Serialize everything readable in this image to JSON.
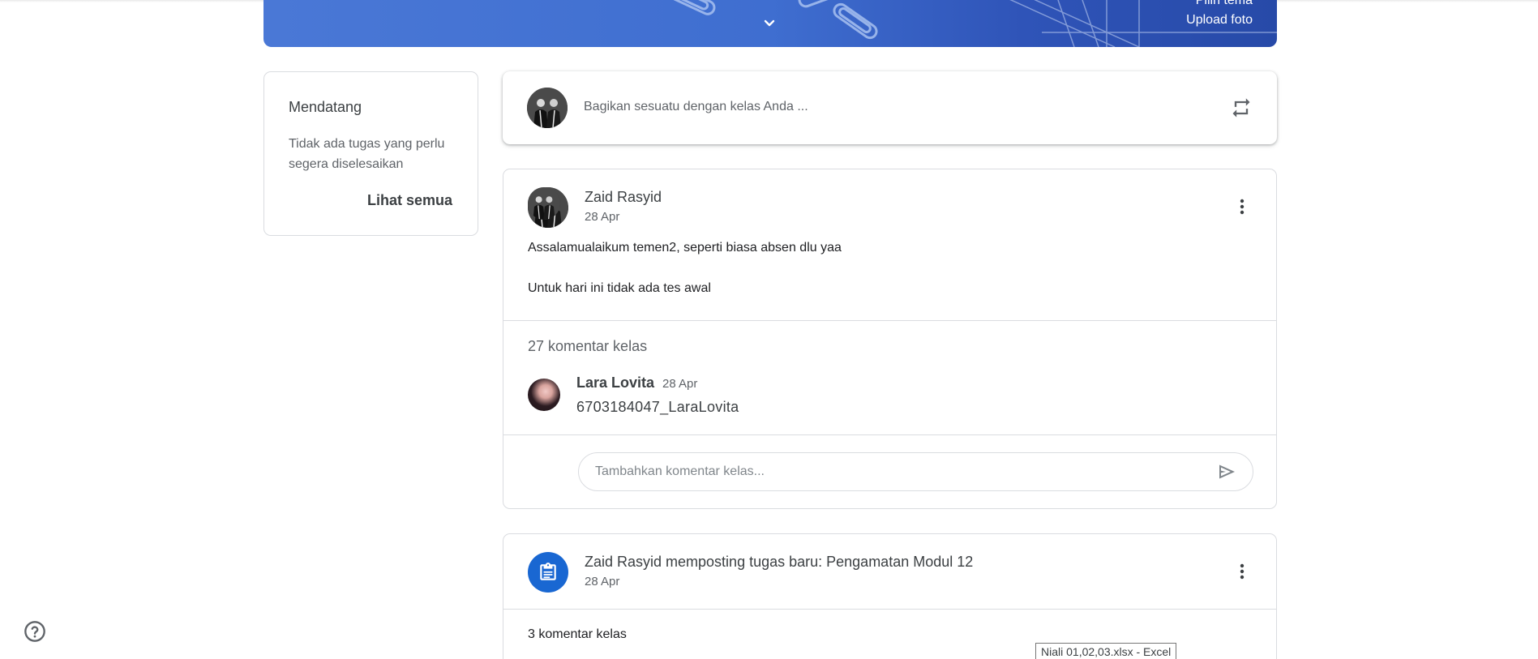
{
  "banner": {
    "theme_label": "Pilih tema",
    "upload_label": "Upload foto",
    "colors": {
      "primary": "#3f6ed0",
      "dark": "#274aa8"
    }
  },
  "upcoming": {
    "title": "Mendatang",
    "empty_text": "Tidak ada tugas yang perlu segera diselesaikan",
    "see_all": "Lihat semua"
  },
  "share": {
    "placeholder": "Bagikan sesuatu dengan kelas Anda ...",
    "icon": "repost-icon"
  },
  "post": {
    "author": "Zaid Rasyid",
    "date": "28 Apr",
    "body_line_1": "Assalamualaikum temen2, seperti biasa absen dlu yaa",
    "body_line_2": "Untuk hari ini tidak ada tes awal",
    "comments_count": "27 komentar kelas",
    "comment": {
      "author": "Lara Lovita",
      "date": "28 Apr",
      "text": "6703184047_LaraLovita"
    },
    "comment_placeholder": "Tambahkan komentar kelas..."
  },
  "post2": {
    "title": "Zaid Rasyid memposting tugas baru: Pengamatan Modul 12",
    "date": "28 Apr",
    "comments_count": "3 komentar kelas",
    "icon": "assignment-icon",
    "accent": "#1967d2"
  },
  "tooltip": {
    "text": "Niali 01,02,03.xlsx - Excel"
  }
}
